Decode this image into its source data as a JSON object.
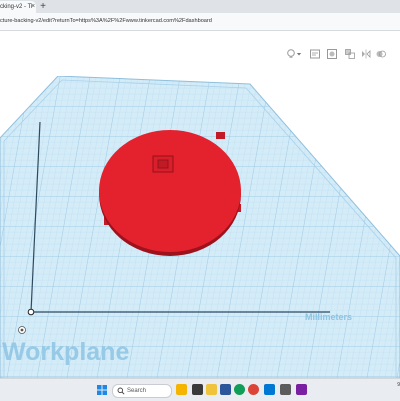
{
  "browser": {
    "tab_title": "cking-v2 - Ti",
    "tab_close": "×",
    "new_tab": "+",
    "url": "cture-backing-v2/edit?returnTo=https%3A%2F%2Fwww.tinkercad.com%2Fdashboard"
  },
  "toolbar": {
    "icons": [
      "lightbulb-icon",
      "dropdown-caret-icon",
      "note-icon",
      "shape-outline-icon",
      "align-icon",
      "mirror-icon",
      "group-icon"
    ]
  },
  "workplane": {
    "label": "Workplane",
    "units": "Millimeters",
    "colors": {
      "grid_bg": "#cfe7f5",
      "grid_line": "#9fcbe6",
      "shape": "#e3222e",
      "shape_edge": "#a8101c"
    }
  },
  "taskbar": {
    "search_placeholder": "Search",
    "tray_right": "9"
  }
}
